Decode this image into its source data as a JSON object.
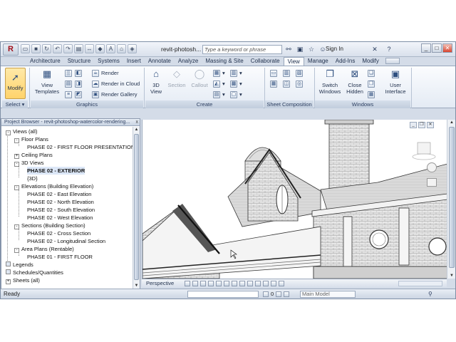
{
  "title_bar": {
    "app_button": "R",
    "window_title": "revit-photosh...",
    "search_placeholder": "Type a keyword or phrase",
    "sign_in": "Sign In",
    "qat_icons": [
      "open-icon",
      "save-icon",
      "sync-icon",
      "undo-icon",
      "redo-icon",
      "print-icon",
      "measure-icon",
      "tag-icon",
      "text-icon",
      "3d-icon",
      "section-icon"
    ]
  },
  "tabs": [
    "Architecture",
    "Structure",
    "Systems",
    "Insert",
    "Annotate",
    "Analyze",
    "Massing & Site",
    "Collaborate",
    "View",
    "Manage",
    "Add-Ins",
    "Modify"
  ],
  "active_tab": "View",
  "ribbon": {
    "select_panel": {
      "modify": "Modify",
      "label": "Select"
    },
    "graphics_panel": {
      "view_templates_1": "View",
      "view_templates_2": "Templates",
      "render": "Render",
      "render_in_cloud": "Render  in Cloud",
      "render_gallery": "Render  Gallery",
      "label": "Graphics"
    },
    "create_panel": {
      "view_3d_1": "3D",
      "view_3d_2": "View",
      "section": "Section",
      "callout": "Callout",
      "label": "Create"
    },
    "sheet_panel": {
      "label": "Sheet Composition"
    },
    "windows_panel": {
      "switch_1": "Switch",
      "switch_2": "Windows",
      "close_1": "Close",
      "close_2": "Hidden",
      "user_1": "User",
      "user_2": "Interface",
      "label": "Windows"
    }
  },
  "project_browser": {
    "title": "Project Browser - revit-photoshop-watercolor-rendering...",
    "close": "x",
    "tree": [
      {
        "t": "Views (all)",
        "lvl": 0,
        "tg": "-"
      },
      {
        "t": "Floor Plans",
        "lvl": 1,
        "tg": "-"
      },
      {
        "t": "PHASE 02  -  FIRST FLOOR PRESENTATION",
        "lvl": 2
      },
      {
        "t": "Ceiling Plans",
        "lvl": 1,
        "tg": "+"
      },
      {
        "t": "3D Views",
        "lvl": 1,
        "tg": "-"
      },
      {
        "t": "PHASE 02 - EXTERIOR",
        "lvl": 2,
        "bold": true
      },
      {
        "t": "{3D}",
        "lvl": 2
      },
      {
        "t": "Elevations (Building Elevation)",
        "lvl": 1,
        "tg": "-"
      },
      {
        "t": "PHASE 02 - East Elevation",
        "lvl": 2
      },
      {
        "t": "PHASE 02 - North Elevation",
        "lvl": 2
      },
      {
        "t": "PHASE 02 - South Elevation",
        "lvl": 2
      },
      {
        "t": "PHASE 02 - West Elevation",
        "lvl": 2
      },
      {
        "t": "Sections (Building Section)",
        "lvl": 1,
        "tg": "-"
      },
      {
        "t": "PHASE 02 - Cross Section",
        "lvl": 2
      },
      {
        "t": "PHASE 02 - Longitudinal Section",
        "lvl": 2
      },
      {
        "t": "Area Plans (Rentable)",
        "lvl": 1,
        "tg": "-"
      },
      {
        "t": "PHASE 01  -  FIRST FLOOR",
        "lvl": 2
      },
      {
        "t": "Legends",
        "lvl": 0,
        "icon": true
      },
      {
        "t": "Schedules/Quantities",
        "lvl": 0,
        "icon": true
      },
      {
        "t": "Sheets (all)",
        "lvl": 0,
        "tg": "+"
      }
    ]
  },
  "viewport": {
    "view_label": "Perspective"
  },
  "status_bar": {
    "ready": "Ready",
    "count": "0",
    "model": "Main Model"
  },
  "colors": {
    "ribbon_active": "#ffd36b",
    "chrome": "#d4dce8",
    "accent": "#1f2f4b"
  }
}
